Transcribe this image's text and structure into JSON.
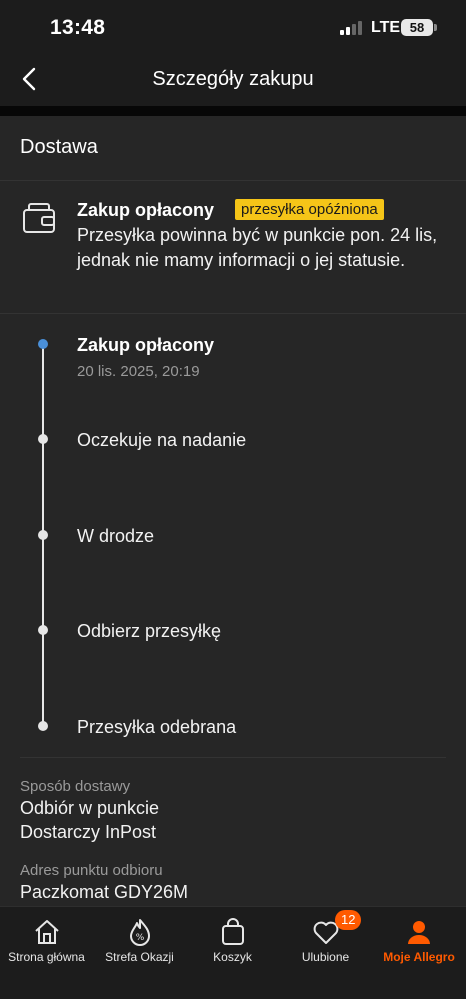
{
  "status_bar": {
    "time": "13:48",
    "network": "LTE",
    "battery": "58"
  },
  "header": {
    "title": "Szczegóły zakupu"
  },
  "section": {
    "title": "Dostawa"
  },
  "status_card": {
    "title": "Zakup opłacony",
    "badge": "przesyłka opóźniona",
    "description": "Przesyłka powinna być w punkcie pon. 24 lis, jednak nie mamy informacji o jej statusie."
  },
  "timeline": [
    {
      "label": "Zakup opłacony",
      "date": "20 lis. 2025, 20:19",
      "active": true
    },
    {
      "label": "Oczekuje na nadanie"
    },
    {
      "label": "W drodze"
    },
    {
      "label": "Odbierz przesyłkę"
    },
    {
      "label": "Przesyłka odebrana"
    }
  ],
  "delivery": {
    "method_label": "Sposób dostawy",
    "method_line1": "Odbiór w punkcie",
    "method_line2": "Dostarczy InPost",
    "address_label": "Adres punktu odbioru",
    "address_value": "Paczkomat GDY26M"
  },
  "bottom_nav": {
    "items": [
      {
        "label": "Strona główna",
        "icon": "home-icon"
      },
      {
        "label": "Strefa Okazji",
        "icon": "deals-icon"
      },
      {
        "label": "Koszyk",
        "icon": "cart-icon"
      },
      {
        "label": "Ulubione",
        "icon": "heart-icon",
        "badge": "12"
      },
      {
        "label": "Moje Allegro",
        "icon": "user-icon",
        "active": true
      }
    ]
  },
  "colors": {
    "accent": "#ff5a00",
    "badge_bg": "#f5c518",
    "timeline_active": "#4a90d9"
  }
}
